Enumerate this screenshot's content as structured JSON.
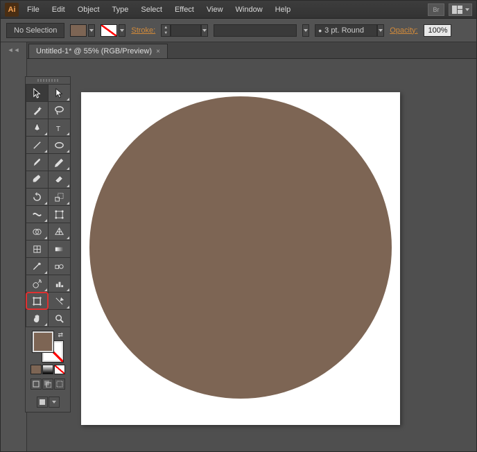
{
  "app_icon_text": "Ai",
  "menubar": [
    "File",
    "Edit",
    "Object",
    "Type",
    "Select",
    "Effect",
    "View",
    "Window",
    "Help"
  ],
  "titlebar_buttons": {
    "br": "Br"
  },
  "controlbar": {
    "selection_label": "No Selection",
    "stroke_label": "Stroke:",
    "stroke_weight": "",
    "stroke_style": "3 pt. Round",
    "opacity_label": "Opacity:",
    "opacity_value": "100%"
  },
  "tab": {
    "title": "Untitled-1* @ 55% (RGB/Preview)",
    "close": "×"
  },
  "colors": {
    "fill": "#7d6554",
    "circle": "#7d6554",
    "artboard_bg": "#ffffff"
  },
  "tools": [
    [
      "selection",
      "direct-selection"
    ],
    [
      "magic-wand",
      "lasso"
    ],
    [
      "pen",
      "type"
    ],
    [
      "line-segment",
      "ellipse"
    ],
    [
      "paintbrush",
      "pencil"
    ],
    [
      "blob-brush",
      "eraser"
    ],
    [
      "rotate",
      "scale"
    ],
    [
      "width",
      "free-transform"
    ],
    [
      "shape-builder",
      "perspective-grid"
    ],
    [
      "mesh",
      "gradient"
    ],
    [
      "eyedropper",
      "blend"
    ],
    [
      "symbol-sprayer",
      "column-graph"
    ],
    [
      "artboard",
      "slice"
    ],
    [
      "hand",
      "zoom"
    ]
  ],
  "highlighted_tool": "artboard"
}
